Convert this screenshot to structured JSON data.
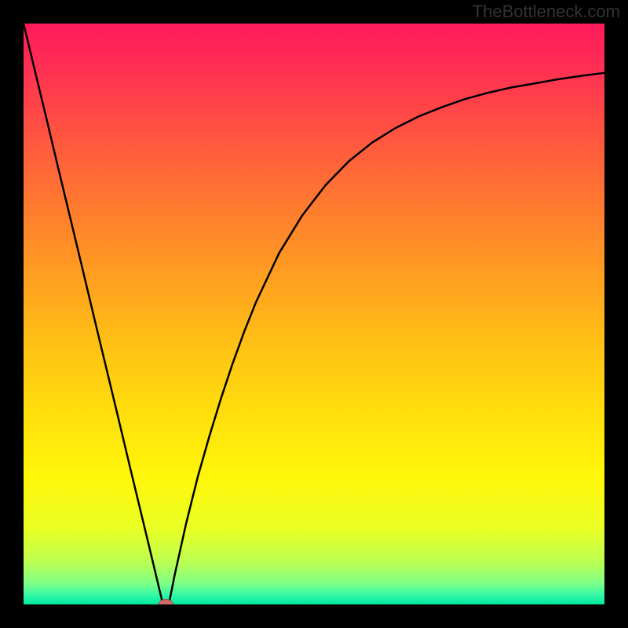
{
  "watermark": "TheBottleneck.com",
  "chart_data": {
    "type": "line",
    "title": "",
    "xlabel": "",
    "ylabel": "",
    "xlim": [
      0,
      100
    ],
    "ylim": [
      0,
      100
    ],
    "x_min_at": 24,
    "series": [
      {
        "name": "curve",
        "x": [
          0,
          2,
          4,
          6,
          8,
          10,
          12,
          14,
          16,
          18,
          20,
          22,
          24,
          25,
          26,
          28,
          30,
          32,
          34,
          36,
          38,
          40,
          44,
          48,
          52,
          56,
          60,
          64,
          68,
          72,
          76,
          80,
          84,
          88,
          92,
          96,
          100
        ],
        "y": [
          100,
          91.7,
          83.4,
          75.0,
          66.7,
          58.4,
          50.0,
          41.7,
          33.4,
          25.0,
          16.7,
          8.4,
          0.0,
          0.0,
          5.0,
          14.0,
          22.0,
          29.0,
          35.5,
          41.5,
          47.0,
          52.0,
          60.5,
          67.0,
          72.2,
          76.3,
          79.5,
          82.0,
          84.0,
          85.6,
          87.0,
          88.1,
          89.0,
          89.7,
          90.4,
          91.0,
          91.5
        ]
      }
    ],
    "marker": {
      "x": 24.5,
      "y": 0
    },
    "gradient_stops": [
      {
        "offset": 0.0,
        "color": "#ff1a5a"
      },
      {
        "offset": 0.06,
        "color": "#ff2a55"
      },
      {
        "offset": 0.15,
        "color": "#ff4747"
      },
      {
        "offset": 0.28,
        "color": "#ff7034"
      },
      {
        "offset": 0.42,
        "color": "#ff9a22"
      },
      {
        "offset": 0.56,
        "color": "#ffc314"
      },
      {
        "offset": 0.68,
        "color": "#ffe00c"
      },
      {
        "offset": 0.78,
        "color": "#fff60a"
      },
      {
        "offset": 0.87,
        "color": "#eaff25"
      },
      {
        "offset": 0.93,
        "color": "#b8ff55"
      },
      {
        "offset": 0.965,
        "color": "#7aff88"
      },
      {
        "offset": 0.985,
        "color": "#30f7a8"
      },
      {
        "offset": 1.0,
        "color": "#00e89a"
      }
    ],
    "colors": {
      "curve": "#000000",
      "marker_fill": "#d46a6a",
      "marker_stroke": "#9c4a4a"
    }
  }
}
